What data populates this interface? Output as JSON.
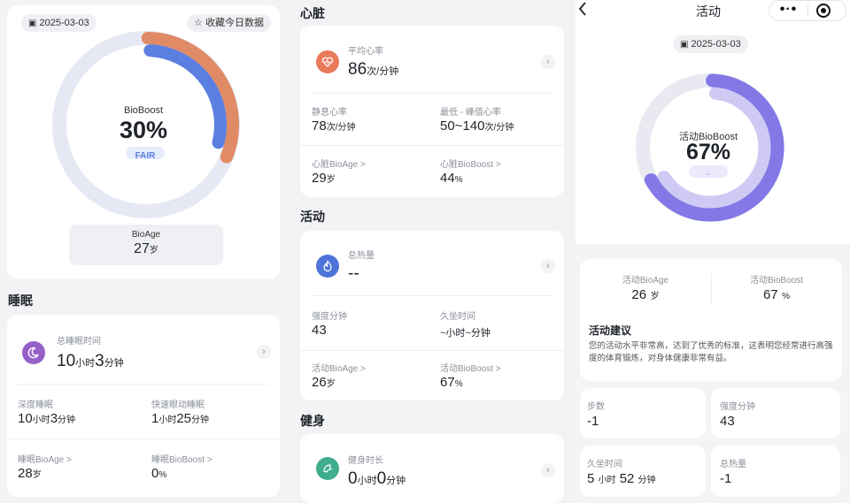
{
  "panel1": {
    "date": "2025-03-03",
    "favorite_label": "收藏今日数据",
    "ring": {
      "label": "BioBoost",
      "value": "30%",
      "badge": "FAIR",
      "fraction": 0.3
    },
    "bioage": {
      "label": "BioAge",
      "value": "27",
      "unit": "岁"
    },
    "sleep_title": "睡眠",
    "sleep": {
      "total_label": "总睡眠时间",
      "total_h": "10",
      "total_h_unit": "小时",
      "total_m": "3",
      "total_m_unit": "分钟",
      "deep_label": "深度睡眠",
      "deep_value": "10",
      "deep_h_unit": "小时",
      "deep_m": "3",
      "deep_m_unit": "分钟",
      "rem_label": "快速眼动睡眠",
      "rem_value": "1",
      "rem_h_unit": "小时",
      "rem_m": "25",
      "rem_m_unit": "分钟",
      "bioage_label": "睡眠BioAge >",
      "bioage_value": "28",
      "bioage_unit": "岁",
      "bioboost_label": "睡眠BioBoost >",
      "bioboost_value": "0",
      "bioboost_unit": "%"
    }
  },
  "panel2": {
    "heart_title": "心脏",
    "heart": {
      "avg_label": "平均心率",
      "avg_value": "86",
      "avg_unit": "次/分钟",
      "rest_label": "静息心率",
      "rest_value": "78",
      "rest_unit": "次/分钟",
      "range_label": "最低 - 峰值心率",
      "range_value": "50~140",
      "range_unit": "次/分钟",
      "bioage_label": "心脏BioAge >",
      "bioage_value": "29",
      "bioage_unit": "岁",
      "bioboost_label": "心脏BioBoost >",
      "bioboost_value": "44",
      "bioboost_unit": "%"
    },
    "activity_title": "活动",
    "activity": {
      "cal_label": "总热量",
      "cal_value": "--",
      "intensity_label": "强度分钟",
      "intensity_value": "43",
      "sedentary_label": "久坐时间",
      "sedentary_value": "~小时~分钟",
      "bioage_label": "活动BioAge >",
      "bioage_value": "26",
      "bioage_unit": "岁",
      "bioboost_label": "活动BioBoost >",
      "bioboost_value": "67",
      "bioboost_unit": "%"
    },
    "fitness_title": "健身",
    "fitness": {
      "dur_label": "健身时长",
      "h": "0",
      "h_unit": "小时",
      "m": "0",
      "m_unit": "分钟"
    }
  },
  "panel3": {
    "back_icon": "chevron-left-icon",
    "title": "活动",
    "more_icon": "more-icon",
    "target_icon": "target-icon",
    "date": "2025-03-03",
    "ring": {
      "label": "活动BioBoost",
      "value": "67%",
      "badge": "-",
      "fraction": 0.67
    },
    "bioage_label": "活动BioAge",
    "bioage_value": "26",
    "bioage_unit": "岁",
    "bioboost_label": "活动BioBoost",
    "bioboost_value": "67",
    "bioboost_unit": "%",
    "advice_title": "活动建议",
    "advice_text": "您的活动水平非常高，达到了优秀的标准，这表明您经常进行高强度的体育锻炼，对身体健康非常有益。",
    "steps_label": "步数",
    "steps_value": "-1",
    "intensity_label": "强度分钟",
    "intensity_value": "43",
    "sedentary_label": "久坐时间",
    "sedentary_h": "5",
    "sedentary_h_unit": "小时",
    "sedentary_m": "52",
    "sedentary_m_unit": "分钟",
    "cal_label": "总热量",
    "cal_value": "-1"
  },
  "colors": {
    "ring_track": "#e6e9f4",
    "ring_blue": "#5b7fe0",
    "ring_orange": "#e08a66",
    "purple": "#8378e6",
    "purple_light": "#cfcaf4"
  }
}
